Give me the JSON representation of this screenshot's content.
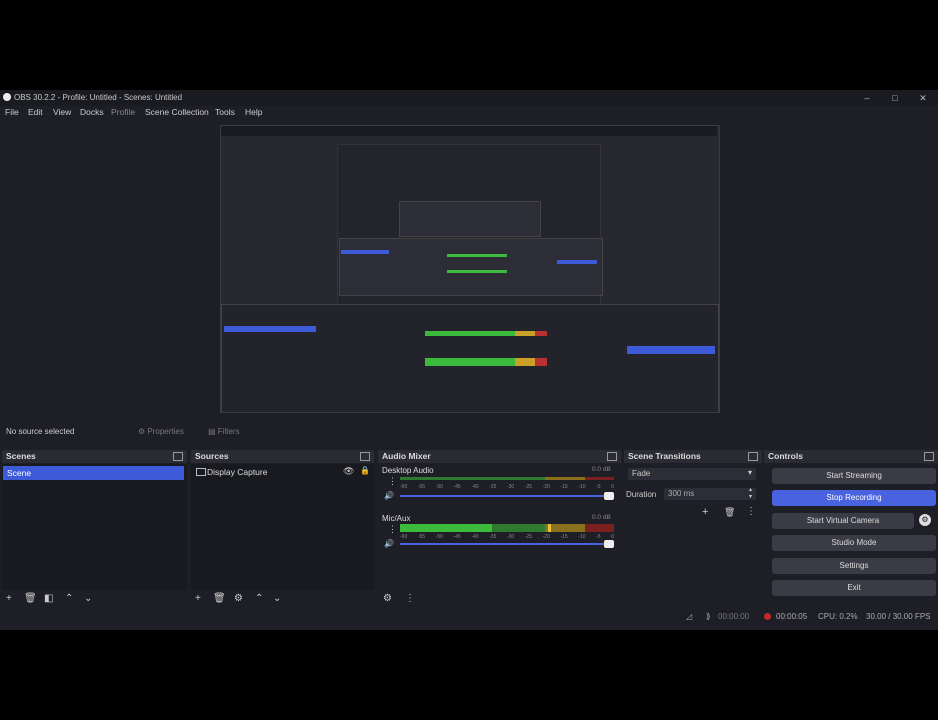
{
  "window": {
    "title": "OBS 30.2.2 - Profile: Untitled - Scenes: Untitled",
    "min_icon": "minimize-icon",
    "max_icon": "maximize-icon",
    "close_icon": "close-icon"
  },
  "menu": [
    "File",
    "Edit",
    "View",
    "Docks",
    "Profile",
    "Scene Collection",
    "Tools",
    "Help"
  ],
  "context_bar": {
    "no_source": "No source selected",
    "properties": "Properties",
    "filters": "Filters"
  },
  "scenes": {
    "title": "Scenes",
    "items": [
      "Scene"
    ]
  },
  "sources": {
    "title": "Sources",
    "items": [
      "Display Capture"
    ]
  },
  "audio_mixer": {
    "title": "Audio Mixer",
    "channels": [
      {
        "name": "Desktop Audio",
        "db": "0.0 dB",
        "level": 0.0
      },
      {
        "name": "Mic/Aux",
        "db": "0.0 dB",
        "level": 0.35
      }
    ],
    "scale": [
      "-60",
      "-55",
      "-50",
      "-45",
      "-40",
      "-35",
      "-30",
      "-25",
      "-20",
      "-15",
      "-10",
      "-5",
      "0"
    ]
  },
  "scene_transitions": {
    "title": "Scene Transitions",
    "transition": "Fade",
    "duration_label": "Duration",
    "duration_value": "300 ms"
  },
  "controls": {
    "title": "Controls",
    "buttons": [
      "Start Streaming",
      "Stop Recording",
      "Start Virtual Camera",
      "Studio Mode",
      "Settings",
      "Exit"
    ]
  },
  "status_bar": {
    "stream_time": "00:00:00",
    "rec_time": "00:00:05",
    "cpu": "CPU: 0.2%",
    "fps": "30.00 / 30.00 FPS"
  },
  "colors": {
    "accent": "#4862e0",
    "background": "#1e1f26",
    "rec": "#c62828"
  }
}
